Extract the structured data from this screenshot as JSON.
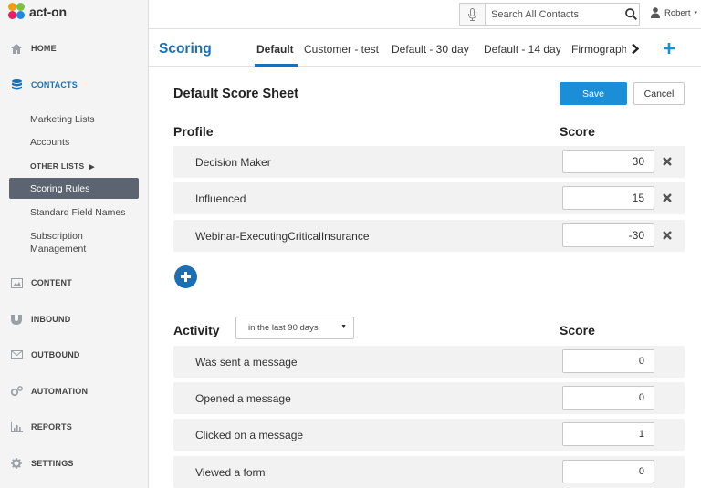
{
  "brand": {
    "name": "act-on"
  },
  "sidebar": {
    "nav": [
      {
        "label": "HOME",
        "icon": "home-icon"
      },
      {
        "label": "CONTACTS",
        "icon": "database-icon"
      },
      {
        "label": "CONTENT",
        "icon": "image-icon"
      },
      {
        "label": "INBOUND",
        "icon": "magnet-icon"
      },
      {
        "label": "OUTBOUND",
        "icon": "envelope-icon"
      },
      {
        "label": "AUTOMATION",
        "icon": "gears-icon"
      },
      {
        "label": "REPORTS",
        "icon": "bar-chart-icon"
      },
      {
        "label": "SETTINGS",
        "icon": "gear-icon"
      }
    ],
    "contacts_sub": {
      "marketing_lists": "Marketing Lists",
      "accounts": "Accounts",
      "other_lists": "OTHER LISTS",
      "scoring_rules": "Scoring Rules",
      "standard_field_names": "Standard Field Names",
      "subscription_line1": "Subscription",
      "subscription_line2": "Management"
    },
    "active_nav": "CONTACTS",
    "selected_sub": "Scoring Rules"
  },
  "header": {
    "search_value": "Search All Contacts",
    "user_name": "Robert"
  },
  "tabbar": {
    "section_title": "Scoring",
    "tabs": [
      "Default",
      "Customer - test",
      "Default - 30 day",
      "Default - 14 day",
      "Firmographic"
    ],
    "active_tab": "Default"
  },
  "main": {
    "sheet_title": "Default Score Sheet",
    "save_label": "Save",
    "cancel_label": "Cancel",
    "profile": {
      "heading": "Profile",
      "score_heading": "Score",
      "rows": [
        {
          "label": "Decision Maker",
          "score": "30"
        },
        {
          "label": "Influenced",
          "score": "15"
        },
        {
          "label": "Webinar-ExecutingCriticalInsurance",
          "score": "-30"
        }
      ]
    },
    "activity": {
      "heading": "Activity",
      "period": "in the last 90 days",
      "score_heading": "Score",
      "rows": [
        {
          "label": "Was sent a message",
          "score": "0"
        },
        {
          "label": "Opened a message",
          "score": "0"
        },
        {
          "label": "Clicked on a message",
          "score": "1"
        },
        {
          "label": "Viewed a form",
          "score": "0"
        }
      ]
    }
  },
  "colors": {
    "accent": "#1a6fb5",
    "save_button": "#1a8fd8",
    "selected_sub_bg": "#5b6470"
  }
}
